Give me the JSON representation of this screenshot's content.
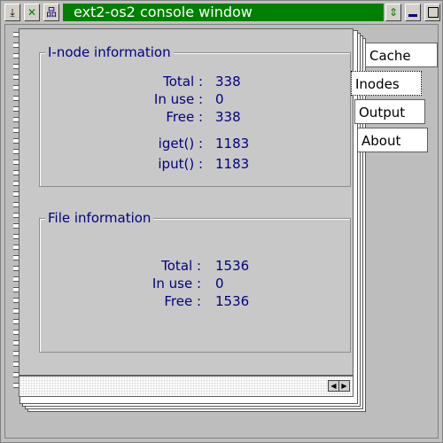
{
  "window": {
    "title": "ext2-os2 console window"
  },
  "titlebar": {
    "sysmenu_icon": "download-arrow-icon",
    "close_icon": "close-x-icon",
    "tree_icon": "tree-icon",
    "scroll_icon": "updown-arrows-icon",
    "minimize_icon": "minimize-icon",
    "maximize_icon": "maximize-icon"
  },
  "tabs": [
    {
      "label": "Cache"
    },
    {
      "label": "Inodes",
      "active": true
    },
    {
      "label": "Output"
    },
    {
      "label": "About"
    }
  ],
  "inode_group": {
    "title": "I-node information",
    "rows": [
      {
        "label": "Total :",
        "value": "338"
      },
      {
        "label": "In use :",
        "value": "0"
      },
      {
        "label": "Free :",
        "value": "338"
      },
      {
        "label": "iget() :",
        "value": "1183"
      },
      {
        "label": "iput() :",
        "value": "1183"
      }
    ]
  },
  "file_group": {
    "title": "File information",
    "rows": [
      {
        "label": "Total :",
        "value": "1536"
      },
      {
        "label": "In use :",
        "value": "0"
      },
      {
        "label": "Free :",
        "value": "1536"
      }
    ]
  },
  "nav": {
    "prev_icon": "arrow-left-icon",
    "next_icon": "arrow-right-icon"
  },
  "colors": {
    "title_bar": "#008000",
    "label_text": "#000080"
  }
}
